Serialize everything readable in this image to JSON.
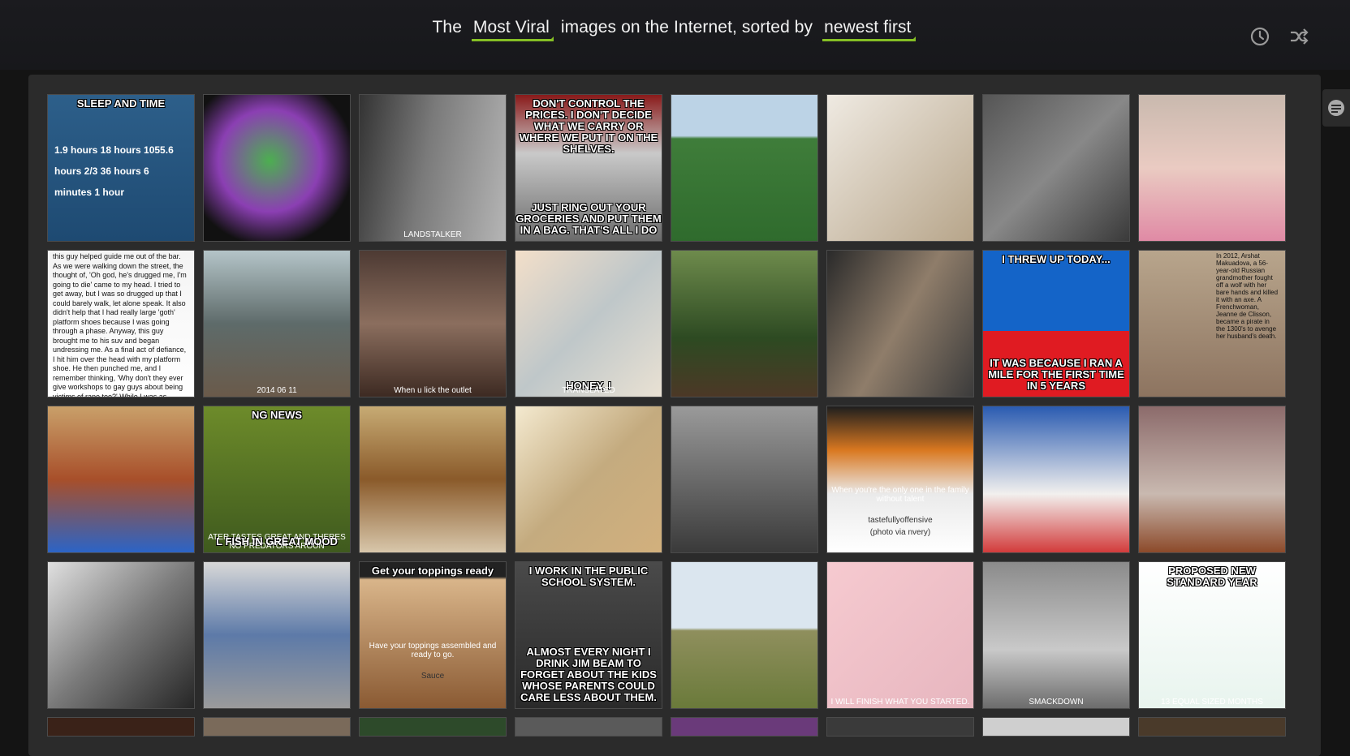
{
  "header": {
    "prefix": "The",
    "section": "Most Viral",
    "middle": "images on the Internet, sorted by",
    "sort": "newest first"
  },
  "icons": [
    "clock-icon",
    "shuffle-icon",
    "comment-icon"
  ],
  "tiles": [
    {
      "caption_top": "SLEEP AND TIME",
      "stats": [
        "1.9 hours",
        "18 hours",
        "1055.6 hours",
        "2/3",
        "36 hours",
        "6 minutes",
        "1 hour"
      ]
    },
    {},
    {
      "small": "LANDSTALKER"
    },
    {
      "caption_top": "DON'T CONTROL THE PRICES. I DON'T DECIDE WHAT WE CARRY OR WHERE WE PUT IT ON THE SHELVES.",
      "caption_bottom": "JUST RING OUT YOUR GROCERIES AND PUT THEM IN A BAG. THAT'S ALL I DO"
    },
    {},
    {},
    {},
    {},
    {
      "doc": "this guy helped guide me out of the bar. As we were walking down the street, the thought of, 'Oh god, he's drugged me, I'm going to die' came to my head. I tried to get away, but I was so drugged up that I could barely walk, let alone speak. It also didn't help that I had really large 'goth' platform shoes because I was going through a phase. Anyway, this guy brought me to his suv and began undressing me. As a final act of defiance, I hit him over the head with my platform shoe. He then punched me, and I remember thinking, 'Why don't they ever give workshops to gay guys about being victims of rape too?' While I was as careful as possible, I never saw the guy slip something in the drink. I even watched the bar tender make the drink. Anyway, I lied there completely paralyzed while this pervert was lubing up. I locked eyes with his"
    },
    {
      "small": "2014 06 11"
    },
    {
      "small": "When u lick the outlet"
    },
    {
      "caption_bottom": "HONEY, I",
      "small": "TRANSLATED"
    },
    {},
    {},
    {
      "caption_top": "I THREW UP TODAY...",
      "caption_bottom": "IT WAS BECAUSE I RAN A MILE FOR THE FIRST TIME IN 5 YEARS"
    },
    {
      "doc": "In 2012, Arshat Makuadova, a 56-year-old Russian grandmother fought off a wolf with her bare hands and killed it with an axe. A Frenchwoman, Jeanne de Clisson, became a pirate in the 1300's to avenge her husband's death."
    },
    {},
    {
      "caption_top": "NG NEWS",
      "caption_bottom": "L FISH IN GREAT MOOD",
      "small": "ATER TASTES GREAT AND THERES NO PREDATORS AROUN"
    },
    {},
    {},
    {},
    {
      "small": "When you're the only one in the family without talent",
      "small2": "tastefullyoffensive",
      "small3": "(photo via nvery)"
    },
    {},
    {},
    {},
    {},
    {
      "caption_top": "Get your toppings ready",
      "small": "Have your toppings assembled and ready to go.",
      "small2": "Sauce"
    },
    {
      "caption_top": "I WORK IN THE PUBLIC SCHOOL SYSTEM.",
      "caption_bottom": "ALMOST EVERY NIGHT I DRINK JIM BEAM TO FORGET ABOUT THE KIDS WHOSE PARENTS COULD CARE LESS ABOUT THEM."
    },
    {},
    {
      "small": "I WILL FINISH WHAT YOU STARTED."
    },
    {
      "small": "SMACKDOWN"
    },
    {
      "caption_top": "PROPOSED NEW STANDARD YEAR",
      "small": "13 EQUAL SIZED MONTHS"
    }
  ]
}
